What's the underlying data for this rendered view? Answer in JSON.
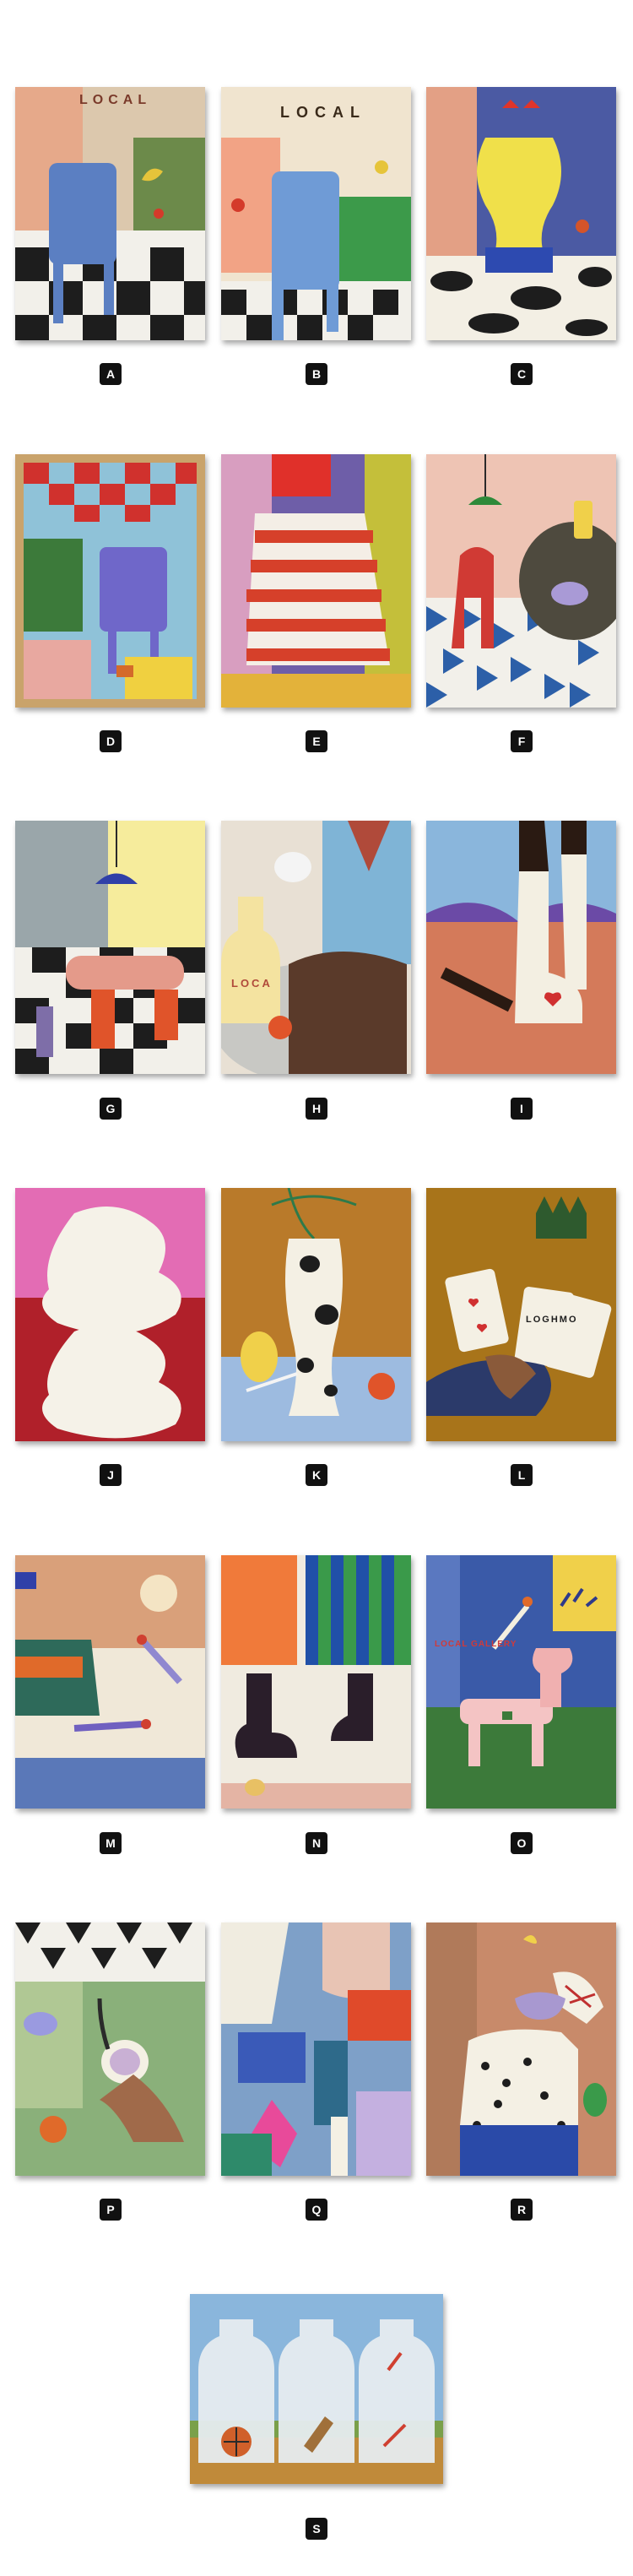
{
  "labels": [
    "A",
    "B",
    "C",
    "D",
    "E",
    "F",
    "G",
    "H",
    "I",
    "J",
    "K",
    "L",
    "M",
    "N",
    "O",
    "P",
    "Q",
    "R",
    "S"
  ],
  "painted_text": {
    "local": "LOCAL",
    "local_h": "LOCA",
    "local_gallery": "LOCAL GALLERY",
    "card_text": "LOGHMO"
  },
  "colors": {
    "frame_edge": "#c9b8a3",
    "label_bg": "#111111",
    "label_text": "#ffffff"
  }
}
